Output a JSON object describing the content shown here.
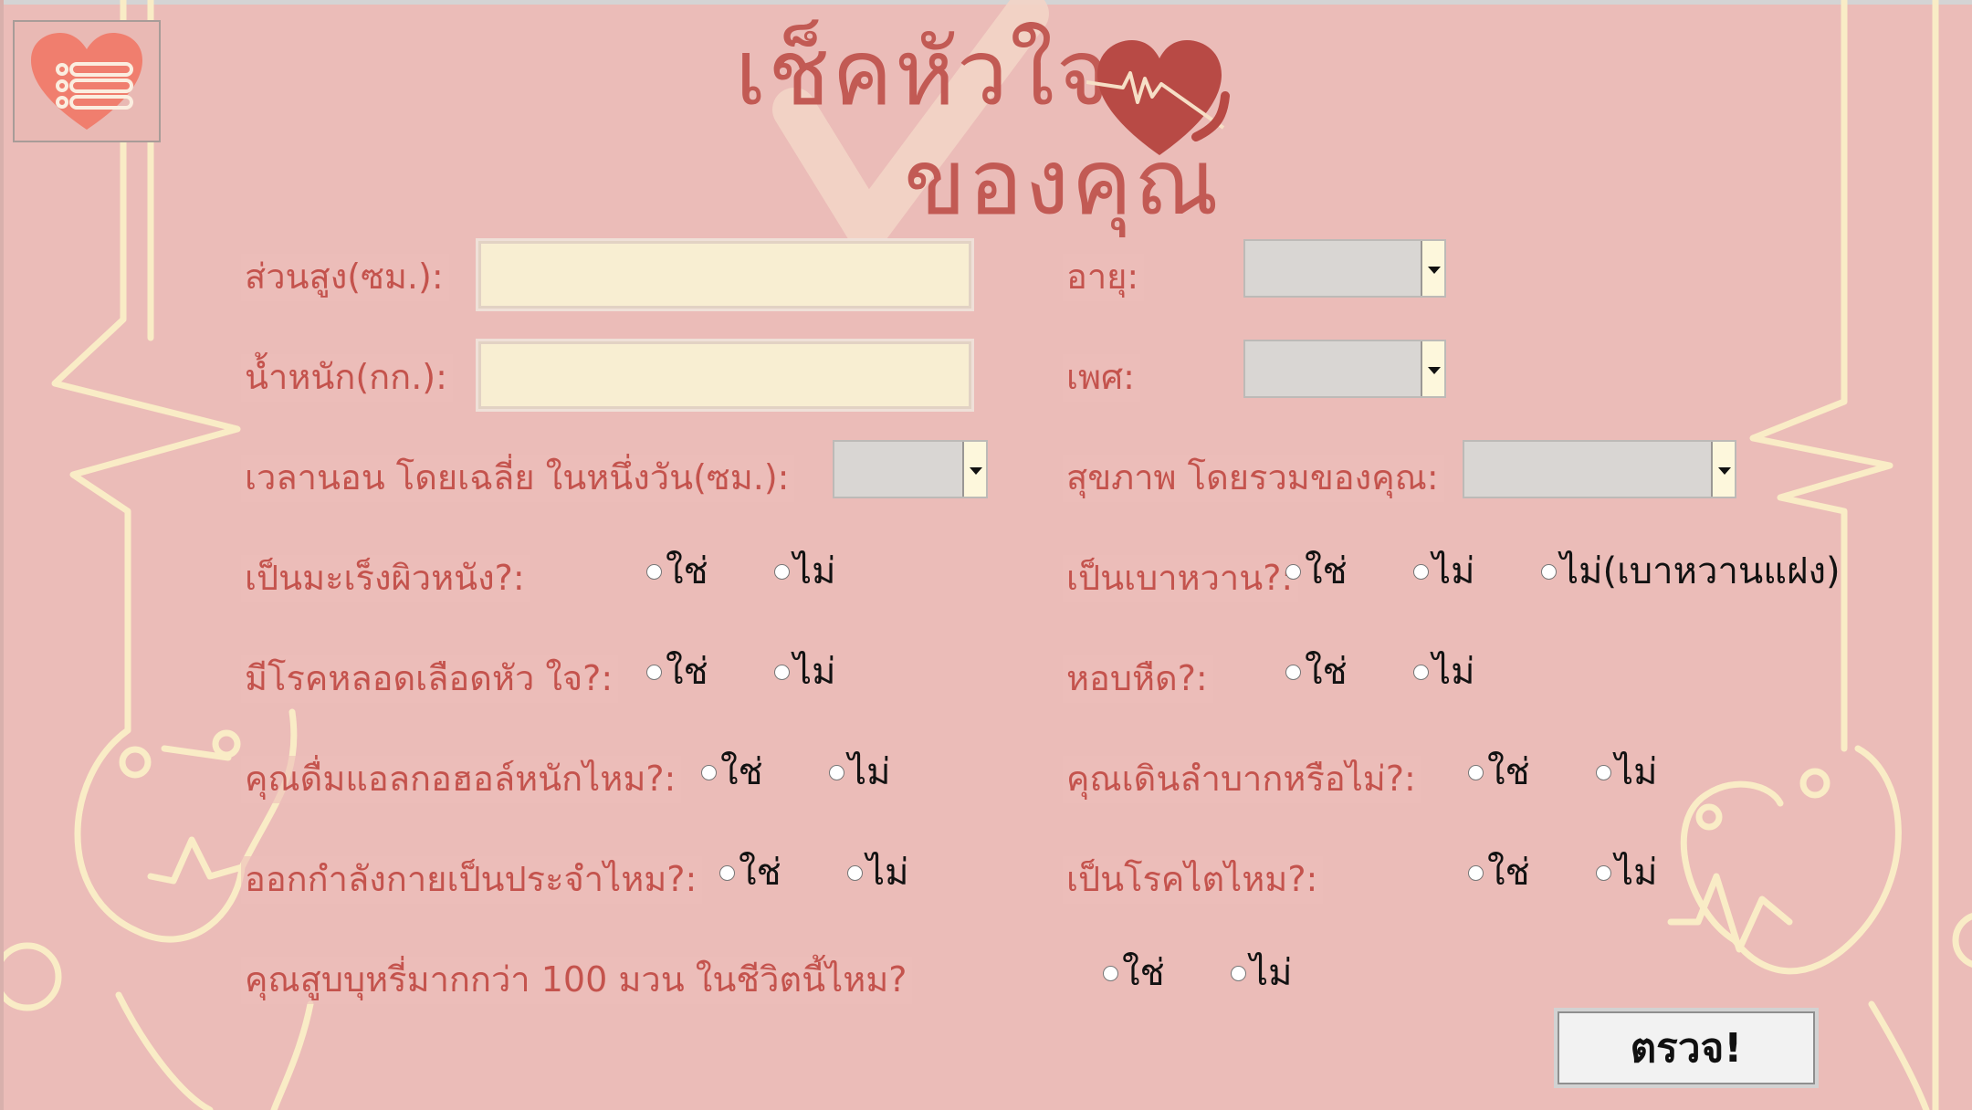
{
  "header": {
    "title_line1": "เช็คหัวใจ",
    "title_line2": "ของคุณ"
  },
  "icons": {
    "menu": "heart-list-icon",
    "title_heart": "heartbeat-heart-icon",
    "watermark": "check-mark-icon"
  },
  "colors": {
    "background": "#ebbcb8",
    "label": "#c4534d",
    "title": "#c25a54",
    "field": "#f8eed2",
    "decoration": "#f9ecc6"
  },
  "form": {
    "height": {
      "label": "ส่วนสูง(ซม.):",
      "value": "",
      "placeholder": ""
    },
    "weight": {
      "label": "น้ำหนัก(กก.):",
      "value": "",
      "placeholder": ""
    },
    "age": {
      "label": "อายุ:",
      "value": ""
    },
    "sex": {
      "label": "เพศ:",
      "value": ""
    },
    "sleep": {
      "label": "เวลานอน โดยเฉลี่ย ในหนึ่งวัน(ซม.):",
      "value": ""
    },
    "general_health": {
      "label": "สุขภาพ โดยรวมของคุณ:",
      "value": ""
    },
    "skin_cancer": {
      "label": "เป็นมะเร็งผิวหนัง?:",
      "options": [
        "ใช่",
        "ไม่"
      ]
    },
    "diabetic": {
      "label": "เป็นเบาหวาน?:",
      "options": [
        "ใช่",
        "ไม่",
        "ไม่(เบาหวานแฝง)"
      ]
    },
    "stroke": {
      "label": "มีโรคหลอดเลือดหัว ใจ?:",
      "options": [
        "ใช่",
        "ไม่"
      ]
    },
    "asthma": {
      "label": "หอบหืด?:",
      "options": [
        "ใช่",
        "ไม่"
      ]
    },
    "alcohol": {
      "label": "คุณดื่มแอลกอฮอล์หนักไหม?:",
      "options": [
        "ใช่",
        "ไม่"
      ]
    },
    "diff_walking": {
      "label": "คุณเดินลำบากหรือไม่?:",
      "options": [
        "ใช่",
        "ไม่"
      ]
    },
    "physical_activity": {
      "label": "ออกกำลังกายเป็นประจำไหม?:",
      "options": [
        "ใช่",
        "ไม่"
      ]
    },
    "kidney_disease": {
      "label": "เป็นโรคไตไหม?:",
      "options": [
        "ใช่",
        "ไม่"
      ]
    },
    "smoking": {
      "label": "คุณสูบบุหรี่มากกว่า 100 มวน ในชีวิตนี้ไหม?",
      "options": [
        "ใช่",
        "ไม่"
      ]
    }
  },
  "submit": {
    "label": "ตรวจ!"
  }
}
